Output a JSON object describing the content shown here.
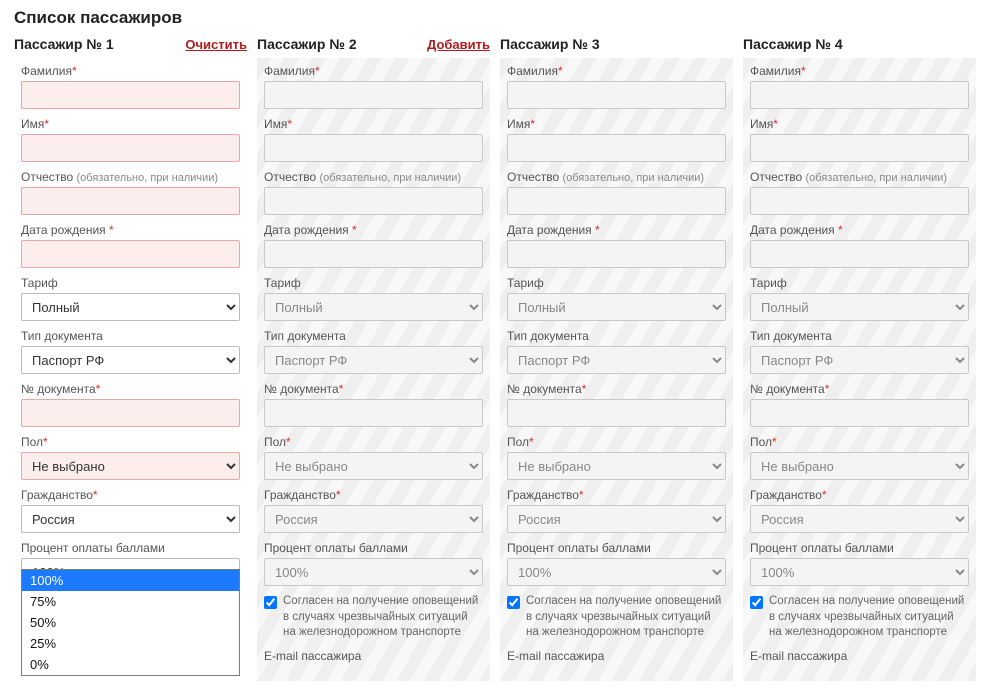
{
  "page_title": "Список пассажиров",
  "labels": {
    "surname": "Фамилия",
    "name": "Имя",
    "patronymic": "Отчество",
    "patronymic_hint": "(обязательно, при наличии)",
    "dob": "Дата рождения",
    "tariff": "Тариф",
    "doc_type": "Тип документа",
    "doc_num": "№ документа",
    "sex": "Пол",
    "citizenship": "Гражданство",
    "points_pct": "Процент оплаты баллами",
    "consent": "Согласен на получение оповещений в случаях чрезвычайных ситуаций на железнодорожном транспорте",
    "email": "E-mail пассажира"
  },
  "values": {
    "tariff": "Полный",
    "doc_type": "Паспорт РФ",
    "sex": "Не выбрано",
    "citizenship": "Россия",
    "points_pct": "100%",
    "points_options": [
      "100%",
      "75%",
      "50%",
      "25%",
      "0%"
    ]
  },
  "passengers": [
    {
      "title": "Пассажир № 1",
      "action": "Очистить",
      "active": true,
      "show_consent": false,
      "listbox_open": true
    },
    {
      "title": "Пассажир № 2",
      "action": "Добавить",
      "active": false,
      "show_consent": true,
      "listbox_open": false
    },
    {
      "title": "Пассажир № 3",
      "action": "",
      "active": false,
      "show_consent": true,
      "listbox_open": false
    },
    {
      "title": "Пассажир № 4",
      "action": "",
      "active": false,
      "show_consent": true,
      "listbox_open": false
    }
  ]
}
